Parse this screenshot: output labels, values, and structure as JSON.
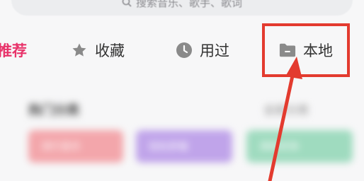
{
  "search": {
    "placeholder": "搜索音乐、歌手、歌词",
    "icon": "search-icon"
  },
  "tabs": [
    {
      "label": "推荐",
      "icon": ""
    },
    {
      "label": "收藏",
      "icon": "star-icon"
    },
    {
      "label": "用过",
      "icon": "clock-icon"
    },
    {
      "label": "本地",
      "icon": "folder-icon"
    }
  ],
  "section": {
    "title": "热门分类",
    "more": "全部分类"
  },
  "cards": [
    {
      "label": "流行音乐"
    },
    {
      "label": "轻松舒缓"
    },
    {
      "label": "清新欢快"
    }
  ],
  "colors": {
    "accent": "#e8336a",
    "annotation_red": "#e33b2f",
    "icon_gray": "#8a8a8a"
  }
}
